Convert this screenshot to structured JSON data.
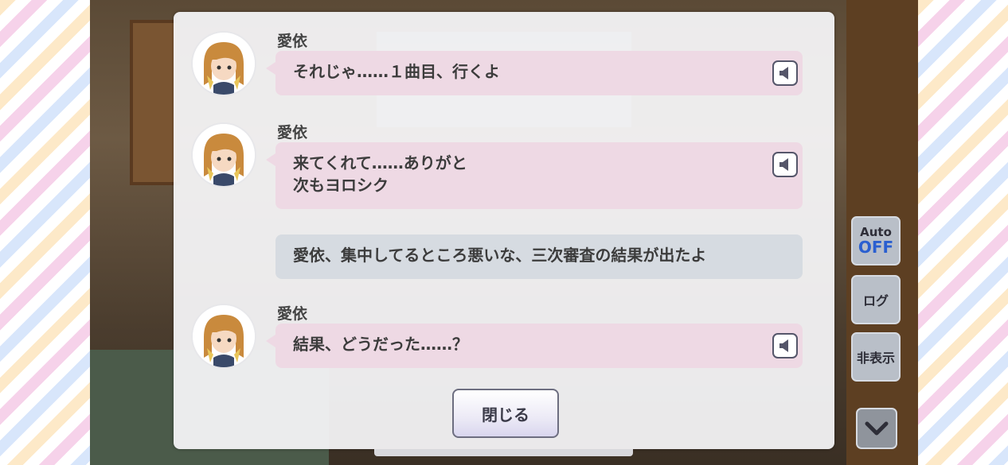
{
  "log": {
    "entries": [
      {
        "type": "character",
        "speaker": "愛依",
        "lines": [
          "それじゃ……１曲目、行くよ"
        ],
        "has_voice": true
      },
      {
        "type": "character",
        "speaker": "愛依",
        "lines": [
          "来てくれて……ありがと",
          "次もヨロシク"
        ],
        "has_voice": true
      },
      {
        "type": "narration",
        "speaker": "",
        "lines": [
          "愛依、集中してるところ悪いな、三次審査の結果が出たよ"
        ],
        "has_voice": false
      },
      {
        "type": "character",
        "speaker": "愛依",
        "lines": [
          "結果、どうだった……？"
        ],
        "has_voice": true
      }
    ],
    "close_label": "閉じる"
  },
  "side_buttons": {
    "auto_label": "Auto",
    "auto_state": "OFF",
    "log_label": "ログ",
    "hide_label": "非表示"
  },
  "colors": {
    "pink_bubble": "#eed9e4",
    "gray_bubble": "#d6dbe1",
    "auto_off": "#2a5fd0"
  },
  "icons": [
    "speaker-icon",
    "chevron-down-icon",
    "avatar"
  ]
}
